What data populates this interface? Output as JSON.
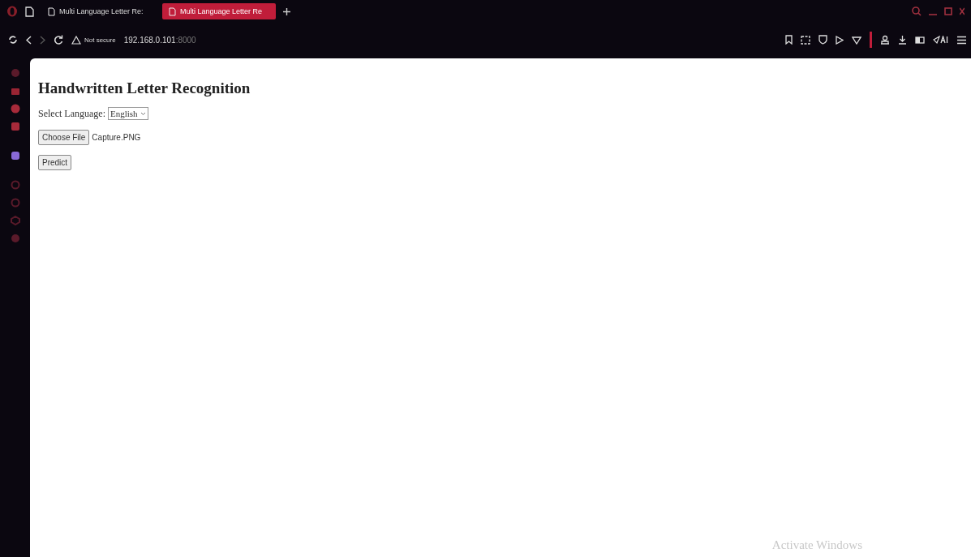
{
  "tabs": [
    {
      "label": "Multi Language Letter Re:",
      "selected": false
    },
    {
      "label": "Multi Language Letter Re",
      "selected": true
    }
  ],
  "address_bar": {
    "security": "Not secure",
    "host": "192.168.0.101",
    "port": ":8000"
  },
  "page": {
    "heading": "Handwritten Letter Recognition",
    "language_label": "Select Language:",
    "language_value": "English",
    "file_button": "Choose File",
    "file_name": "Capture.PNG",
    "predict_button": "Predict"
  },
  "os_overlay": {
    "text": "Activate Windows"
  }
}
